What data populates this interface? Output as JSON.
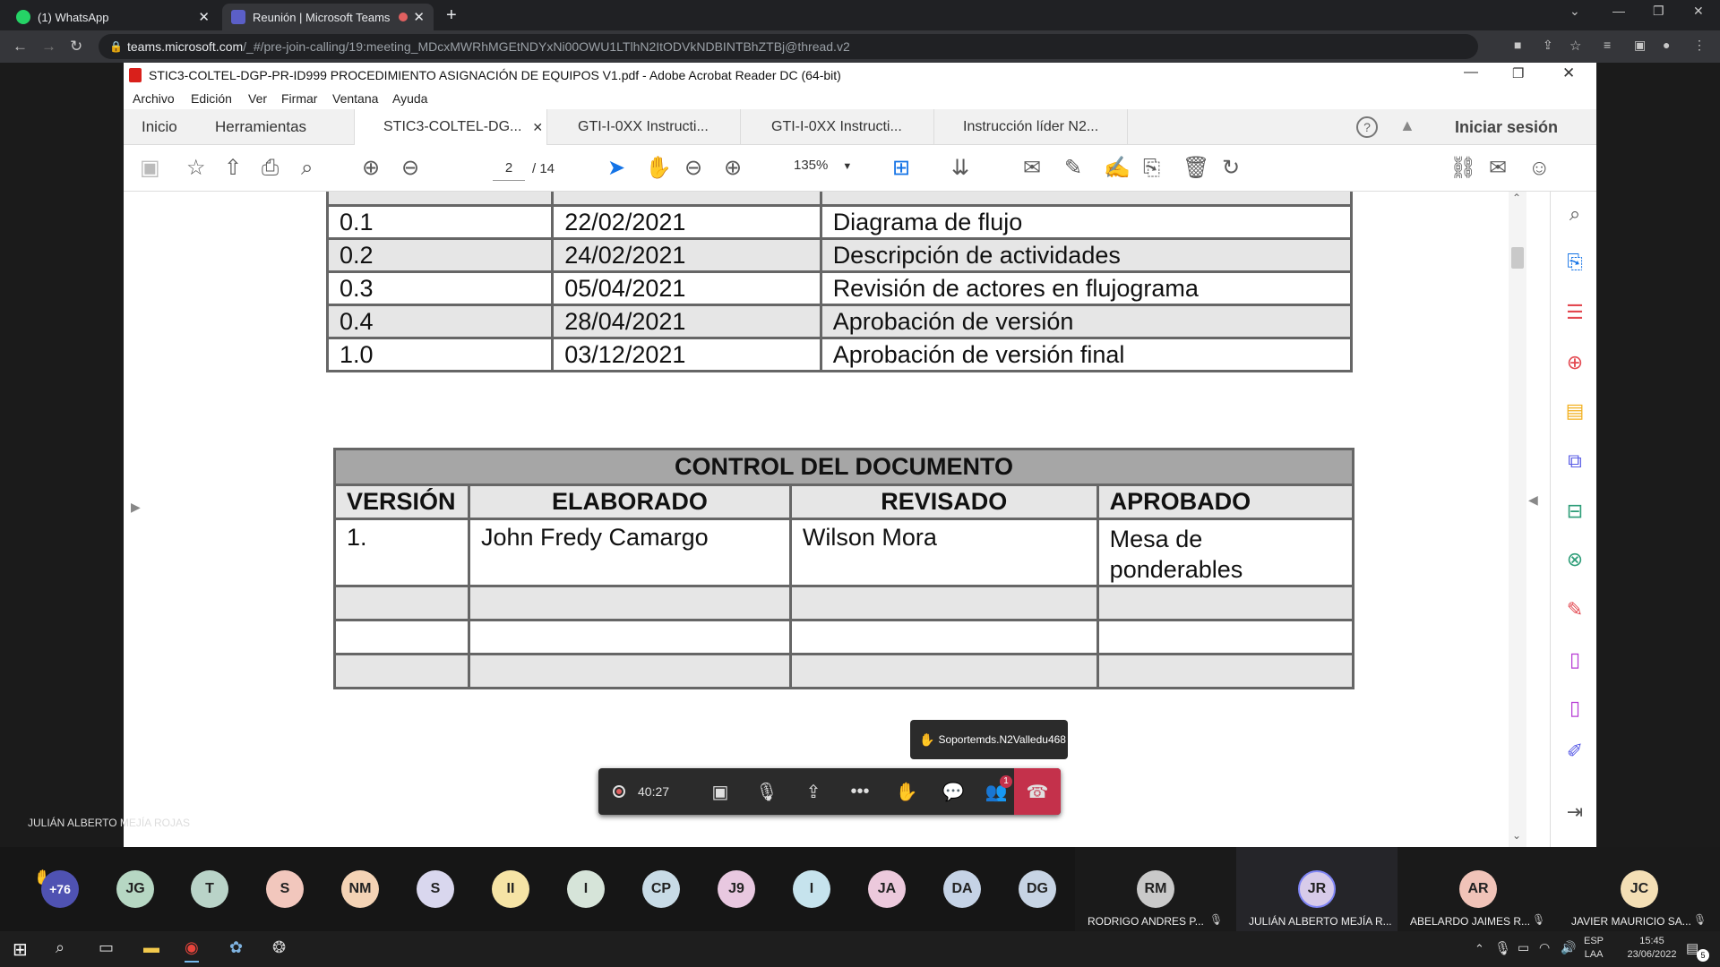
{
  "browser": {
    "tabs": [
      {
        "title": "(1) WhatsApp",
        "active": false
      },
      {
        "title": "Reunión | Microsoft Teams",
        "active": true
      }
    ],
    "url_host": "teams.microsoft.com",
    "url_path": "/_#/pre-join-calling/19:meeting_MDcxMWRhMGEtNDYxNi00OWU1LTlhN2ItODVkNDBINTBhZTBj@thread.v2"
  },
  "acrobat": {
    "window_title": "STIC3-COLTEL-DGP-PR-ID999 PROCEDIMIENTO ASIGNACIÓN DE EQUIPOS V1.pdf - Adobe Acrobat Reader DC (64-bit)",
    "menu": [
      "Archivo",
      "Edición",
      "Ver",
      "Firmar",
      "Ventana",
      "Ayuda"
    ],
    "nav": {
      "home": "Inicio",
      "tools": "Herramientas"
    },
    "doc_tabs": [
      {
        "label": "STIC3-COLTEL-DG...",
        "active": true
      },
      {
        "label": "GTI-I-0XX Instructi...",
        "active": false
      },
      {
        "label": "GTI-I-0XX Instructi...",
        "active": false
      },
      {
        "label": "Instrucción líder N2...",
        "active": false
      }
    ],
    "sign_in": "Iniciar sesión",
    "page_current": "2",
    "page_total": "/ 14",
    "zoom": "135%"
  },
  "revisions": [
    {
      "version": "0.1",
      "date": "22/02/2021",
      "description": "Diagrama de flujo"
    },
    {
      "version": "0.2",
      "date": "24/02/2021",
      "description": "Descripción de actividades"
    },
    {
      "version": "0.3",
      "date": "05/04/2021",
      "description": "Revisión de actores en flujograma"
    },
    {
      "version": "0.4",
      "date": "28/04/2021",
      "description": "Aprobación de versión"
    },
    {
      "version": "1.0",
      "date": "03/12/2021",
      "description": "Aprobación de versión final"
    }
  ],
  "control": {
    "title": "CONTROL DEL DOCUMENTO",
    "headers": [
      "VERSIÓN",
      "ELABORADO",
      "REVISADO",
      "APROBADO"
    ],
    "rows": [
      [
        "1.",
        "John Fredy Camargo",
        "Wilson Mora",
        "Mesa de ponderables"
      ],
      [
        "",
        "",
        "",
        ""
      ],
      [
        "",
        "",
        "",
        ""
      ],
      [
        "",
        "",
        "",
        ""
      ]
    ]
  },
  "teams": {
    "call_duration": "40:27",
    "raised_hand_toast": "Soportemds.N2Valledu468",
    "participants_badge": "1",
    "presenter_label": "JULIÁN ALBERTO MEJÍA ROJAS",
    "overflow_count": "+76",
    "avatars": [
      {
        "initials": "JG",
        "color": "#b6d7c3"
      },
      {
        "initials": "T",
        "color": "#b9d3c8"
      },
      {
        "initials": "S",
        "color": "#f2c7bd"
      },
      {
        "initials": "NM",
        "color": "#f4d3b5"
      },
      {
        "initials": "S",
        "color": "#d9d7ee"
      },
      {
        "initials": "II",
        "color": "#f6e4a5"
      },
      {
        "initials": "I",
        "color": "#d6e4d9"
      },
      {
        "initials": "CP",
        "color": "#c8dbe6"
      },
      {
        "initials": "J9",
        "color": "#e8c8e0"
      },
      {
        "initials": "I",
        "color": "#c6e3ed"
      },
      {
        "initials": "JA",
        "color": "#ecc9dc"
      },
      {
        "initials": "DA",
        "color": "#c5d3e6"
      },
      {
        "initials": "DG",
        "color": "#c7d4e4"
      }
    ],
    "named": [
      {
        "initials": "RM",
        "name": "RODRIGO ANDRES P...",
        "color": "#c9c9c9"
      },
      {
        "initials": "JR",
        "name": "JULIÁN ALBERTO MEJÍA R...",
        "color": "#d7cbe9"
      },
      {
        "initials": "AR",
        "name": "ABELARDO JAIMES R...",
        "color": "#f0c3b8"
      },
      {
        "initials": "JC",
        "name": "JAVIER MAURICIO SA...",
        "color": "#f4dfb5"
      }
    ]
  },
  "taskbar": {
    "lang": "ESP",
    "layout": "LAA",
    "time": "15:45",
    "date": "23/06/2022",
    "notifications": "5"
  }
}
